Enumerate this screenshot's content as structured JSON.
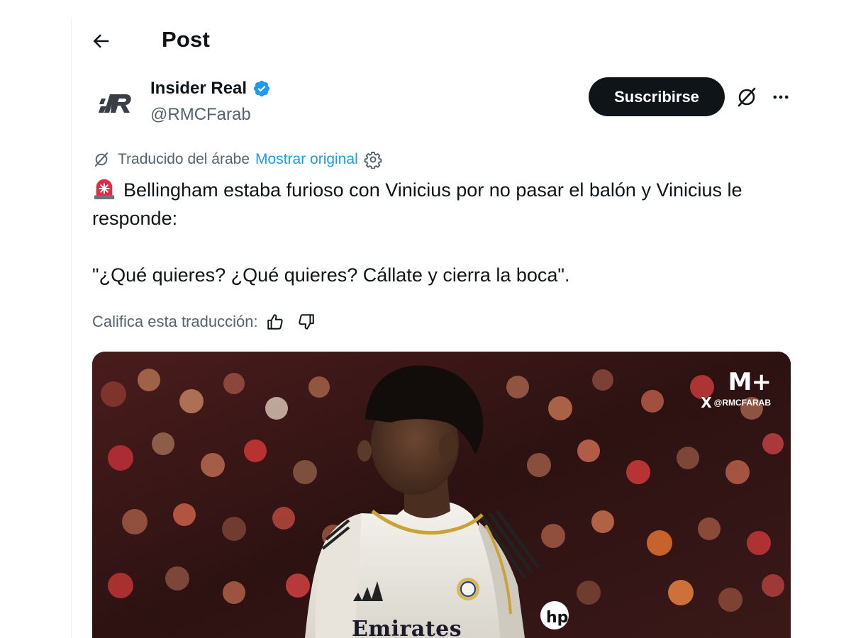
{
  "header": {
    "title": "Post",
    "back_icon": "arrow-left-icon"
  },
  "author": {
    "name": "Insider Real",
    "handle": "@RMCFarab",
    "verified": true,
    "verified_color": "#1d9bf0",
    "avatar_text": "iR"
  },
  "actions": {
    "subscribe_label": "Suscribirse",
    "grok_icon": "grok-icon",
    "more_icon": "more-horizontal-icon"
  },
  "translation": {
    "translated_from": "Traducido del árabe",
    "show_original": "Mostrar original",
    "link_color": "#1d9bf0"
  },
  "post": {
    "line1": "Bellingham estaba furioso con Vinicius por no pasar el balón y Vinicius le responde:",
    "line2": "\"¿Qué quieres? ¿Qué quieres? Cállate y cierra la boca\"."
  },
  "rating": {
    "label": "Califica esta traducción:"
  },
  "media": {
    "watermark_brand": "M+",
    "watermark_handle": "@RMCFARAB",
    "watermark_x": "X",
    "jersey_text": "Emirates"
  }
}
